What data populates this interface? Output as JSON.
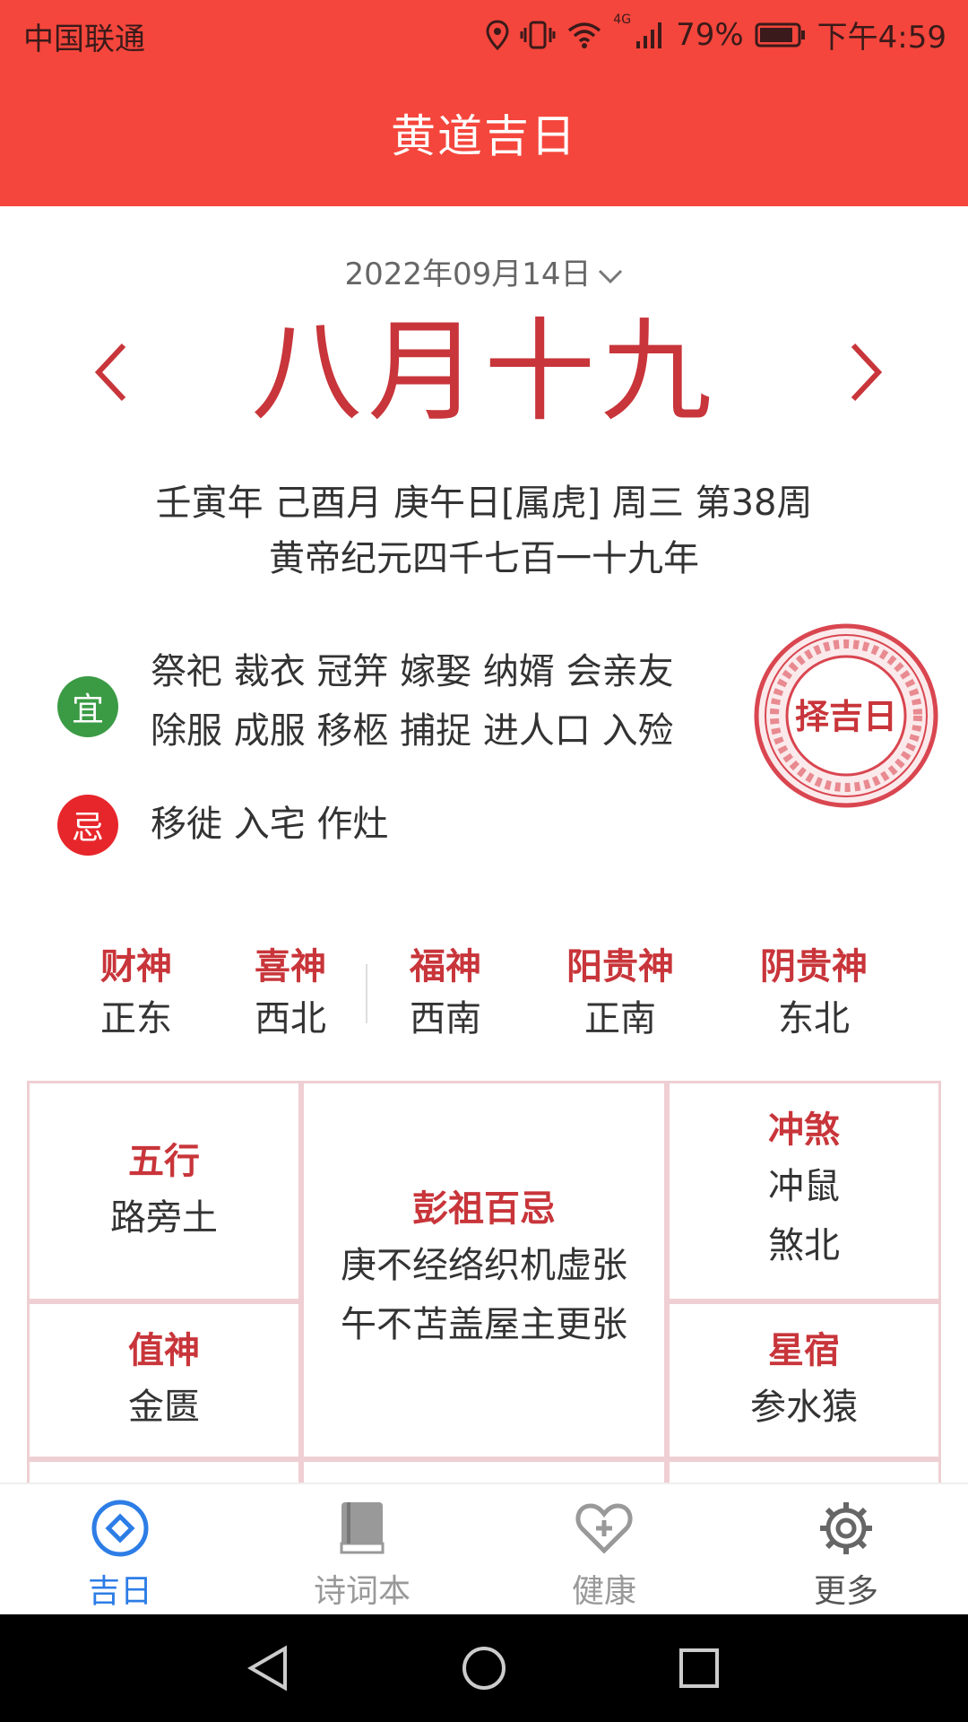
{
  "status": {
    "carrier": "中国联通",
    "signal_label": "4G",
    "battery": "79%",
    "time": "下午4:59"
  },
  "header": {
    "title": "黄道吉日"
  },
  "date_selector": {
    "label": "2022年09月14日"
  },
  "lunar_date": "八月十九",
  "ganzhi_line1": "壬寅年 己酉月 庚午日[属虎] 周三 第38周",
  "ganzhi_line2": "黄帝纪元四千七百一十九年",
  "yi": {
    "badge": "宜",
    "line1": "祭祀 裁衣 冠笄 嫁娶 纳婿 会亲友",
    "line2": "除服 成服 移柩 捕捉 进人口 入殓"
  },
  "ji": {
    "badge": "忌",
    "line1": "移徙 入宅 作灶"
  },
  "seal_text": "择吉日",
  "gods": [
    {
      "title": "财神",
      "value": "正东"
    },
    {
      "title": "喜神",
      "value": "西北"
    },
    {
      "title": "福神",
      "value": "西南"
    },
    {
      "title": "阳贵神",
      "value": "正南"
    },
    {
      "title": "阴贵神",
      "value": "东北"
    }
  ],
  "grid": {
    "wuxing": {
      "title": "五行",
      "value": "路旁土"
    },
    "pengzu": {
      "title": "彭祖百忌",
      "line1": "庚不经络织机虚张",
      "line2": "午不苫盖屋主更张"
    },
    "chongsha": {
      "title": "冲煞",
      "line1": "冲鼠",
      "line2": "煞北"
    },
    "zhishen": {
      "title": "值神",
      "value": "金匮"
    },
    "xingxiu": {
      "title": "星宿",
      "value": "参水猿"
    }
  },
  "tabs": [
    {
      "label": "吉日",
      "icon": "diamond-circle-icon"
    },
    {
      "label": "诗词本",
      "icon": "book-icon"
    },
    {
      "label": "健康",
      "icon": "heart-plus-icon"
    },
    {
      "label": "更多",
      "icon": "gear-icon"
    }
  ],
  "colors": {
    "header_bg": "#f4463c",
    "accent_red": "#c8353a",
    "yi_green": "#3b9b45",
    "ji_red": "#e7262b",
    "tab_active": "#2d7de6"
  }
}
